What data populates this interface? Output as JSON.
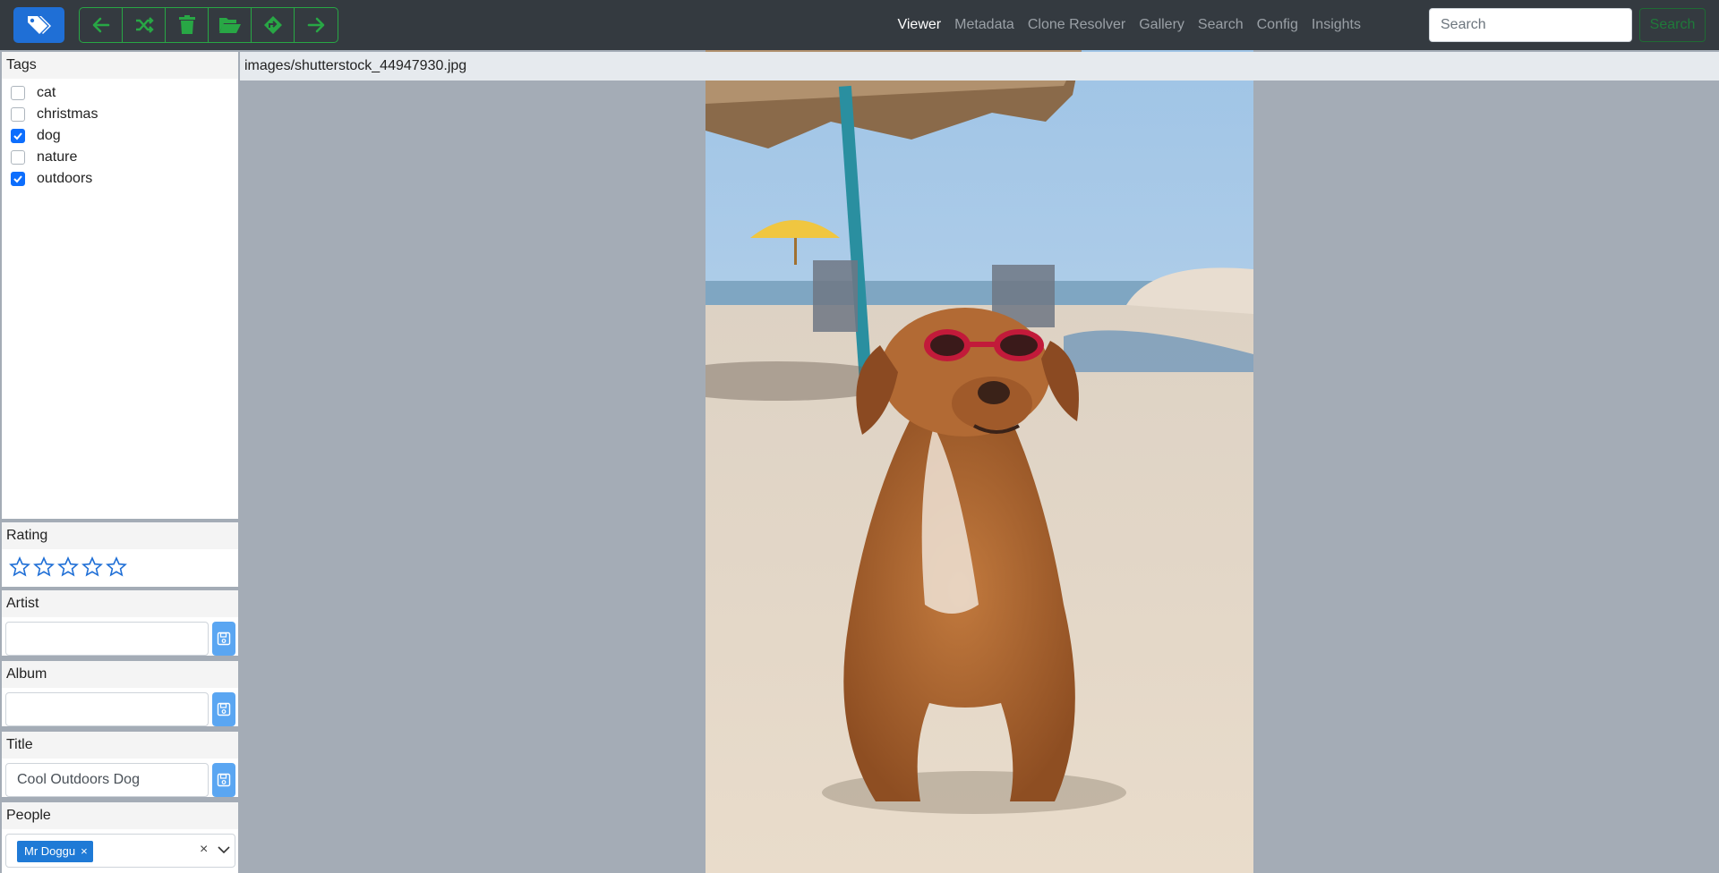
{
  "navbar": {
    "brand_icon": "tags-icon",
    "toolbar": [
      {
        "name": "previous-button",
        "icon": "arrow-left-icon"
      },
      {
        "name": "random-button",
        "icon": "shuffle-icon"
      },
      {
        "name": "delete-button",
        "icon": "trash-icon"
      },
      {
        "name": "open-folder-button",
        "icon": "folder-open-icon"
      },
      {
        "name": "move-button",
        "icon": "sign-turn-icon"
      },
      {
        "name": "next-button",
        "icon": "arrow-right-icon"
      }
    ],
    "links": [
      "Viewer",
      "Metadata",
      "Clone Resolver",
      "Gallery",
      "Search",
      "Config",
      "Insights"
    ],
    "active_link": "Viewer",
    "search": {
      "placeholder": "Search",
      "value": "",
      "button_label": "Search"
    }
  },
  "sidebar": {
    "tags": {
      "header": "Tags",
      "items": [
        {
          "label": "cat",
          "checked": false
        },
        {
          "label": "christmas",
          "checked": false
        },
        {
          "label": "dog",
          "checked": true
        },
        {
          "label": "nature",
          "checked": false
        },
        {
          "label": "outdoors",
          "checked": true
        }
      ]
    },
    "rating": {
      "header": "Rating",
      "stars": 5,
      "value": 0
    },
    "artist": {
      "header": "Artist",
      "value": ""
    },
    "album": {
      "header": "Album",
      "value": ""
    },
    "title": {
      "header": "Title",
      "value": "Cool Outdoors Dog"
    },
    "people": {
      "header": "People",
      "tags": [
        "Mr Doggu"
      ]
    }
  },
  "viewer": {
    "path": "images/shutterstock_44947930.jpg",
    "image_subject": "dog wearing red sunglasses sitting on beach sand"
  },
  "colors": {
    "accent_green": "#28a745",
    "brand_blue": "#1f6fd6",
    "navbar_bg": "#343a40",
    "viewer_bg": "#a4acb6"
  }
}
